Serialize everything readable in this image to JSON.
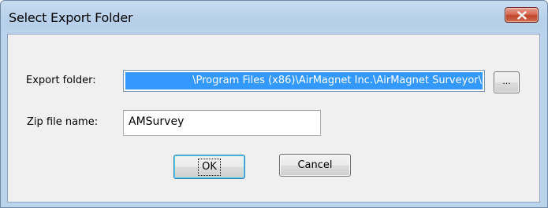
{
  "dialog": {
    "title": "Select Export Folder",
    "close_icon": "close-x-icon"
  },
  "export_folder": {
    "label": "Export folder:",
    "value": "\\Program Files (x86)\\AirMagnet Inc.\\AirMagnet Surveyor\\",
    "browse_label": "..."
  },
  "zip_file": {
    "label": "Zip file name:",
    "value": "AMSurvey"
  },
  "buttons": {
    "ok_label": "OK",
    "cancel_label": "Cancel"
  },
  "colors": {
    "selection": "#3399ff",
    "close_button": "#c7503a",
    "title_bar": "#b9d1ea"
  }
}
